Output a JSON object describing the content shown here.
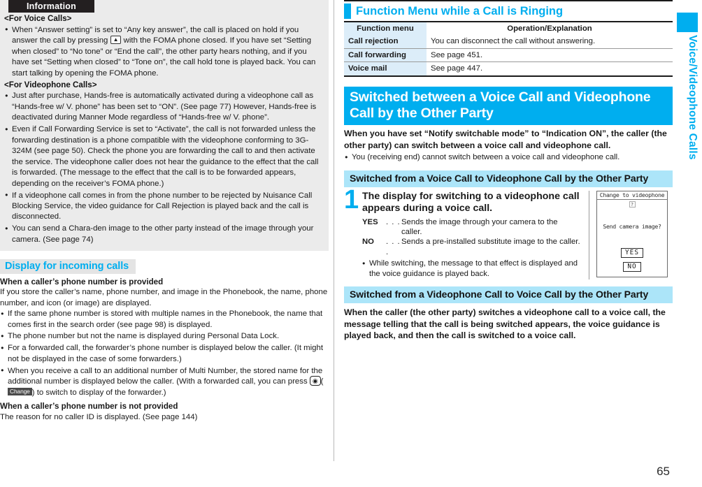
{
  "page": {
    "number": "65",
    "side_tab_label": "Voice/Videophone Calls",
    "accent_cyan": "#00aeef",
    "light_blue": "#ace5f9",
    "table_col_blue": "#dcedf9",
    "info_bg": "#ebebeb"
  },
  "information": {
    "title": "Information",
    "voice_heading": "<For Voice Calls>",
    "voice_bullets": [
      {
        "part1": "When “Answer setting” is set to “Any key answer”, the call is placed on hold if you answer the call by pressing ",
        "key": "▲",
        "part2": " with the FOMA phone closed. If you have set “Setting when closed” to “No tone” or “End the call”, the other party hears nothing, and if you have set “Setting when closed” to “Tone on”, the call hold tone is played back. You can start talking by opening the FOMA phone."
      }
    ],
    "videophone_heading": "<For Videophone Calls>",
    "videophone_bullets": [
      "Just after purchase, Hands-free is automatically activated during a videophone call as “Hands-free w/ V. phone” has been set to “ON”. (See page 77) However, Hands-free is deactivated during Manner Mode regardless of “Hands-free w/ V. phone”.",
      "Even if Call Forwarding Service is set to “Activate”, the call is not forwarded unless the forwarding destination is a phone compatible with the videophone conforming to 3G-324M (see page 50). Check the phone you are forwarding the call to and then activate the service. The videophone caller does not hear the guidance to the effect that the call is forwarded. (The message to the effect that the call is to be forwarded appears, depending on the receiver’s FOMA phone.)",
      "If a videophone call comes in from the phone number to be rejected by Nuisance Call Blocking Service, the video guidance for Call Rejection is played back and the call is disconnected.",
      "You can send a Chara-den image to the other party instead of the image through your camera. (See page 74)"
    ]
  },
  "display_incoming": {
    "heading": "Display for incoming calls",
    "provided_heading": "When a caller’s phone number is provided",
    "provided_text": "If you store the caller’s name, phone number, and image in the Phonebook, the name, phone number, and icon (or image) are displayed.",
    "provided_bullets": [
      {
        "text": "If the same phone number is stored with multiple names in the Phonebook, the name that comes first in the search order (see page 98) is displayed."
      },
      {
        "text": "The phone number but not the name is displayed during Personal Data Lock."
      },
      {
        "text": "For a forwarded call, the forwarder’s phone number is displayed below the caller. (It might not be displayed in the case of some forwarders.)"
      }
    ],
    "multi_number_bullet": {
      "part1": "When you receive a call to an additional number of Multi Number, the stored name for the additional number is displayed below the caller. (With a forwarded call, you can press ",
      "camera_icon": "◉",
      "paren_open": "(",
      "softkey": "Change",
      "paren_close": ")",
      "part2": " to switch to display of the forwarder.)"
    },
    "not_provided_heading": "When a caller’s phone number is not provided",
    "not_provided_text": "The reason for no caller ID is displayed. (See page 144)"
  },
  "function_menu": {
    "heading": "Function Menu while a Call is Ringing",
    "columns": [
      "Function menu",
      "Operation/Explanation"
    ],
    "rows": [
      [
        "Call rejection",
        "You can disconnect the call without answering."
      ],
      [
        "Call forwarding",
        "See page 451."
      ],
      [
        "Voice mail",
        "See page 447."
      ]
    ]
  },
  "switched_section": {
    "banner": "Switched between a Voice Call and Videophone Call by the Other Party",
    "lead": "When you have set “Notify switchable mode” to “Indication ON”, the caller (the other party) can switch between a voice call and videophone call.",
    "lead_bullet": "You (receiving end) cannot switch between a voice call and videophone call."
  },
  "voice_to_video": {
    "heading": "Switched from a Voice Call to Videophone Call by the Other Party",
    "step_number": "1",
    "step_title": "The display for switching to a videophone call appears during a voice call.",
    "choices": [
      {
        "label": "YES",
        "dots": ". . .",
        "desc": "Sends the image through your camera to the caller."
      },
      {
        "label": "NO",
        "dots": ". . . .",
        "desc": "Sends a pre-installed substitute image to the caller."
      }
    ],
    "note_bullet": "While switching, the message to that effect is displayed and the voice guidance is played back.",
    "phone_screen": {
      "title": "Change to videophone",
      "question_mark": "?",
      "message": "Send camera image?",
      "yes": "YES",
      "no": "NO"
    }
  },
  "video_to_voice": {
    "heading": "Switched from a Videophone Call to Voice Call by the Other Party",
    "text": "When the caller (the other party) switches a videophone call to a voice call, the message telling that the call is being switched appears, the voice guidance is played back, and then the call is switched to a voice call."
  }
}
